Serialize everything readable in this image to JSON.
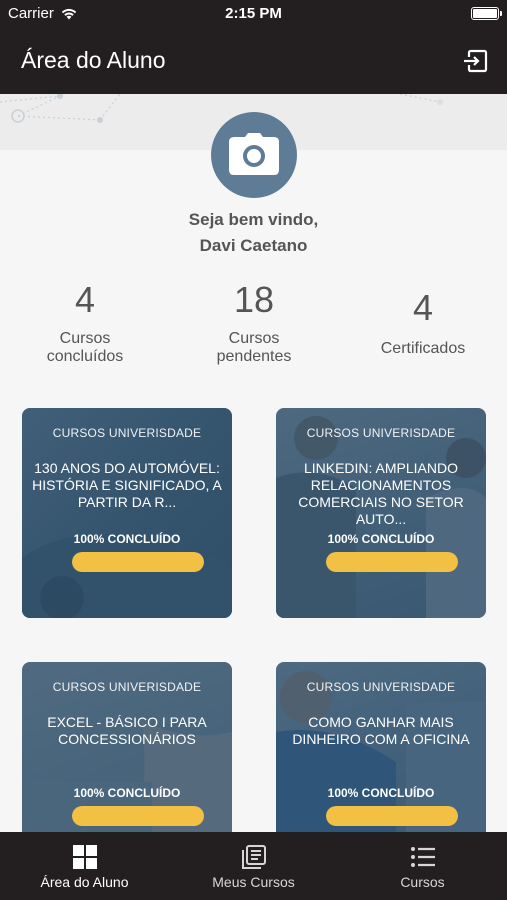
{
  "status_bar": {
    "carrier": "Carrier",
    "time": "2:15 PM"
  },
  "header": {
    "title": "Área do Aluno"
  },
  "profile": {
    "welcome": "Seja bem vindo,",
    "name": "Davi Caetano"
  },
  "stats": [
    {
      "value": "4",
      "label_line1": "Cursos",
      "label_line2": "concluídos"
    },
    {
      "value": "18",
      "label_line1": "Cursos",
      "label_line2": "pendentes"
    },
    {
      "value": "4",
      "label_line1": "Certificados",
      "label_line2": ""
    }
  ],
  "courses": [
    {
      "category": "CURSOS UNIVERISDADE",
      "title": "130 ANOS DO AUTOMÓVEL: HISTÓRIA E SIGNIFICADO, A PARTIR DA R...",
      "progress_label": "100% CONCLUÍDO",
      "progress": 1.0
    },
    {
      "category": "CURSOS UNIVERISDADE",
      "title": "LINKEDIN: AMPLIANDO RELACIONAMENTOS COMERCIAIS NO SETOR AUTO...",
      "progress_label": "100% CONCLUÍDO",
      "progress": 1.0
    },
    {
      "category": "CURSOS UNIVERISDADE",
      "title": "EXCEL - BÁSICO I PARA CONCESSIONÁRIOS",
      "progress_label": "100% CONCLUÍDO",
      "progress": 1.0
    },
    {
      "category": "CURSOS UNIVERISDADE",
      "title": "COMO GANHAR MAIS DINHEIRO COM A OFICINA",
      "progress_label": "100% CONCLUÍDO",
      "progress": 1.0
    }
  ],
  "tabs": [
    {
      "label": "Área do Aluno",
      "icon": "dashboard-icon",
      "active": true
    },
    {
      "label": "Meus Cursos",
      "icon": "library-icon",
      "active": false
    },
    {
      "label": "Cursos",
      "icon": "list-icon",
      "active": false
    }
  ],
  "colors": {
    "bar_bg": "#231f20",
    "accent": "#f2c144",
    "avatar": "#5f7c97"
  }
}
